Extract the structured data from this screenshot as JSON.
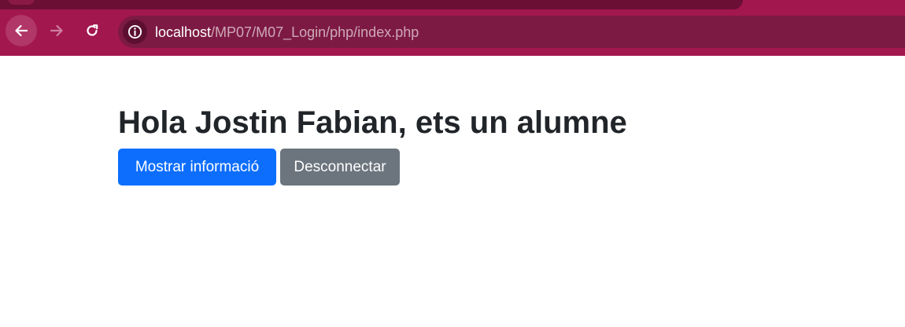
{
  "browser": {
    "url_host": "localhost",
    "url_path": "/MP07/M07_Login/php/index.php"
  },
  "icons": {
    "back": "arrow-left-icon",
    "forward": "arrow-right-icon",
    "reload": "reload-icon",
    "site_info": "info-icon"
  },
  "colors": {
    "chrome": "#a3174f",
    "omnibox": "#7d1a43",
    "primary": "#0d6efd",
    "secondary": "#6c757d",
    "title": "#212529"
  },
  "page": {
    "title": "Hola Jostin Fabian, ets un alumne",
    "buttons": {
      "show_info": "Mostrar informació",
      "disconnect": "Desconnectar"
    }
  }
}
